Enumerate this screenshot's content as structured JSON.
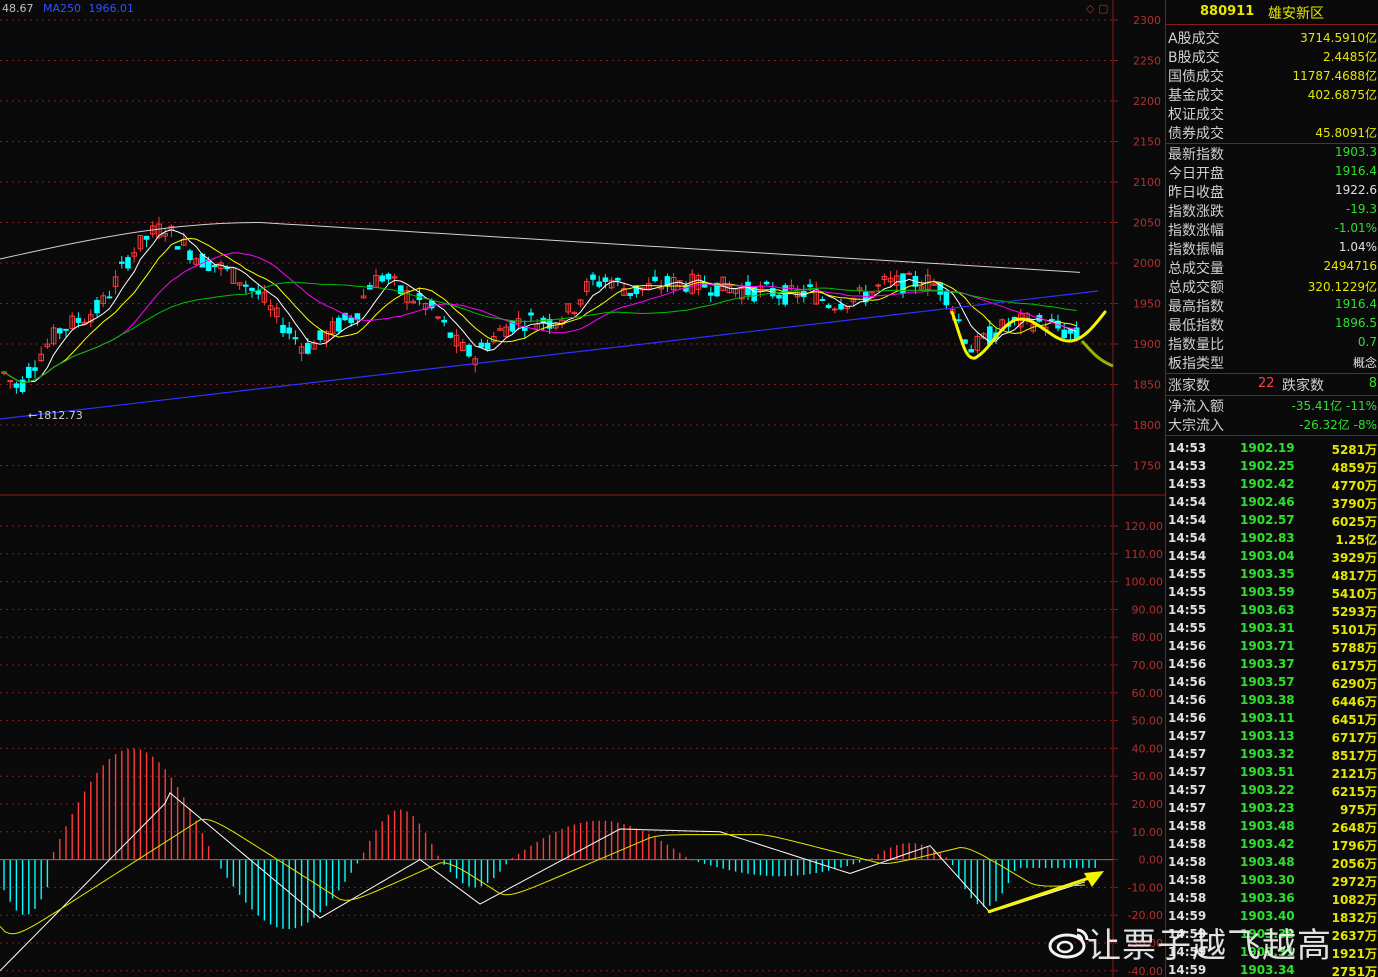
{
  "chart_header": {
    "left_value": "48.67",
    "ma_label": "MA250",
    "ma_value": "1966.01"
  },
  "annotation_low": "←1812.73",
  "price_axis": [
    "2300",
    "2250",
    "2200",
    "2150",
    "2100",
    "2050",
    "2000",
    "1950",
    "1900",
    "1850",
    "1800",
    "1750"
  ],
  "macd_axis": [
    "120.00",
    "110.00",
    "100.00",
    "90.00",
    "80.00",
    "70.00",
    "60.00",
    "50.00",
    "40.00",
    "30.00",
    "20.00",
    "10.00",
    "0.00",
    "-10.00",
    "-20.00",
    "-30.00",
    "-40.00"
  ],
  "panel": {
    "code": "880911",
    "name": "雄安新区",
    "volume_rows": [
      {
        "label": "A股成交",
        "value": "3714.5910亿"
      },
      {
        "label": "B股成交",
        "value": "2.4485亿"
      },
      {
        "label": "国债成交",
        "value": "11787.4688亿"
      },
      {
        "label": "基金成交",
        "value": "402.6875亿"
      },
      {
        "label": "权证成交",
        "value": ""
      },
      {
        "label": "债券成交",
        "value": "45.8091亿"
      }
    ],
    "index_rows": [
      {
        "label": "最新指数",
        "value": "1903.3",
        "color": "#2ee02e"
      },
      {
        "label": "今日开盘",
        "value": "1916.4",
        "color": "#2ee02e"
      },
      {
        "label": "昨日收盘",
        "value": "1922.6",
        "color": "#e0e0e0"
      },
      {
        "label": "指数涨跌",
        "value": "-19.3",
        "color": "#2ee02e"
      },
      {
        "label": "指数涨幅",
        "value": "-1.01%",
        "color": "#2ee02e"
      },
      {
        "label": "指数振幅",
        "value": "1.04%",
        "color": "#e0e0e0"
      },
      {
        "label": "总成交量",
        "value": "2494716",
        "color": "#e6e600"
      },
      {
        "label": "总成交额",
        "value": "320.1229亿",
        "color": "#e6e600"
      },
      {
        "label": "最高指数",
        "value": "1916.4",
        "color": "#2ee02e"
      },
      {
        "label": "最低指数",
        "value": "1896.5",
        "color": "#2ee02e"
      },
      {
        "label": "指数量比",
        "value": "0.7",
        "color": "#2ee02e"
      },
      {
        "label": "板指类型",
        "value": "概念",
        "color": "#e0e0e0"
      }
    ],
    "updown": {
      "up_label": "涨家数",
      "up_value": "22",
      "down_label": "跌家数",
      "down_value": "8"
    },
    "flow_rows": [
      {
        "label": "净流入额",
        "value": "-35.41亿 -11%"
      },
      {
        "label": "大宗流入",
        "value": "-26.32亿 -8%"
      }
    ],
    "ticks": [
      {
        "t": "14:53",
        "p": "1902.19",
        "q": "5281万"
      },
      {
        "t": "14:53",
        "p": "1902.25",
        "q": "4859万"
      },
      {
        "t": "14:53",
        "p": "1902.42",
        "q": "4770万"
      },
      {
        "t": "14:54",
        "p": "1902.46",
        "q": "3790万"
      },
      {
        "t": "14:54",
        "p": "1902.57",
        "q": "6025万"
      },
      {
        "t": "14:54",
        "p": "1902.83",
        "q": "1.25亿"
      },
      {
        "t": "14:54",
        "p": "1903.04",
        "q": "3929万"
      },
      {
        "t": "14:55",
        "p": "1903.35",
        "q": "4817万"
      },
      {
        "t": "14:55",
        "p": "1903.59",
        "q": "5410万"
      },
      {
        "t": "14:55",
        "p": "1903.63",
        "q": "5293万"
      },
      {
        "t": "14:55",
        "p": "1903.31",
        "q": "5101万"
      },
      {
        "t": "14:56",
        "p": "1903.71",
        "q": "5788万"
      },
      {
        "t": "14:56",
        "p": "1903.37",
        "q": "6175万"
      },
      {
        "t": "14:56",
        "p": "1903.57",
        "q": "6290万"
      },
      {
        "t": "14:56",
        "p": "1903.38",
        "q": "6446万"
      },
      {
        "t": "14:56",
        "p": "1903.11",
        "q": "6451万"
      },
      {
        "t": "14:57",
        "p": "1903.13",
        "q": "6717万"
      },
      {
        "t": "14:57",
        "p": "1903.32",
        "q": "8517万"
      },
      {
        "t": "14:57",
        "p": "1903.51",
        "q": "2121万"
      },
      {
        "t": "14:57",
        "p": "1903.22",
        "q": "6215万"
      },
      {
        "t": "14:57",
        "p": "1903.23",
        "q": "975万"
      },
      {
        "t": "14:58",
        "p": "1903.48",
        "q": "2648万"
      },
      {
        "t": "14:58",
        "p": "1903.42",
        "q": "1796万"
      },
      {
        "t": "14:58",
        "p": "1903.48",
        "q": "2056万"
      },
      {
        "t": "14:58",
        "p": "1903.30",
        "q": "2972万"
      },
      {
        "t": "14:58",
        "p": "1903.36",
        "q": "1082万"
      },
      {
        "t": "14:59",
        "p": "1903.40",
        "q": "1832万"
      },
      {
        "t": "14:59",
        "p": "1903.38",
        "q": "2637万"
      },
      {
        "t": "14:59",
        "p": "1903.31",
        "q": "1921万"
      },
      {
        "t": "14:59",
        "p": "1903.34",
        "q": "2751万"
      }
    ]
  },
  "watermark": "让票子越飞越高",
  "colors": {
    "up": "#ff3b3b",
    "down": "#00ffff",
    "ma5": "#ffffff",
    "ma10": "#ffff00",
    "ma20": "#ff00ff",
    "ma60": "#00c000",
    "ma120": "#d0d0d0",
    "ma250": "#3030ff",
    "grid": "#8a1a1a",
    "highlight": "#f5f500"
  }
}
